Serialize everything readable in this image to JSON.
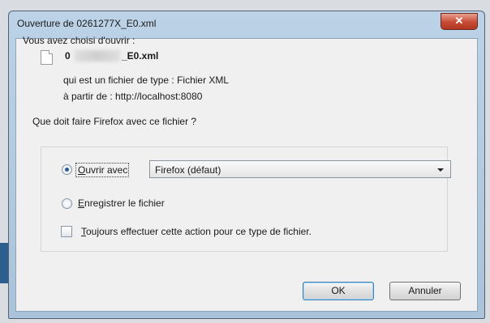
{
  "window": {
    "title": "Ouverture de 0261277X_E0.xml",
    "close_label": "✕"
  },
  "intro": "Vous avez choisi d'ouvrir :",
  "file": {
    "name_prefix": "0",
    "name_suffix": "_E0.xml",
    "type_line": "qui est un fichier de type :  Fichier XML",
    "source_line": "à partir de :  http://localhost:8080"
  },
  "question": "Que doit faire Firefox avec ce fichier ?",
  "options": {
    "open_with": {
      "label_first": "O",
      "label_rest": "uvrir avec",
      "checked": true
    },
    "app_select": {
      "value": "Firefox (défaut)"
    },
    "save": {
      "label_first": "E",
      "label_rest": "nregistrer le fichier",
      "checked": false
    },
    "always": {
      "label_first": "T",
      "label_rest": "oujours effectuer cette action pour ce type de fichier.",
      "checked": false
    }
  },
  "buttons": {
    "ok": "OK",
    "cancel": "Annuler"
  },
  "icons": {
    "file": "document-icon",
    "close": "close-icon",
    "dropdown": "chevron-down-icon"
  }
}
